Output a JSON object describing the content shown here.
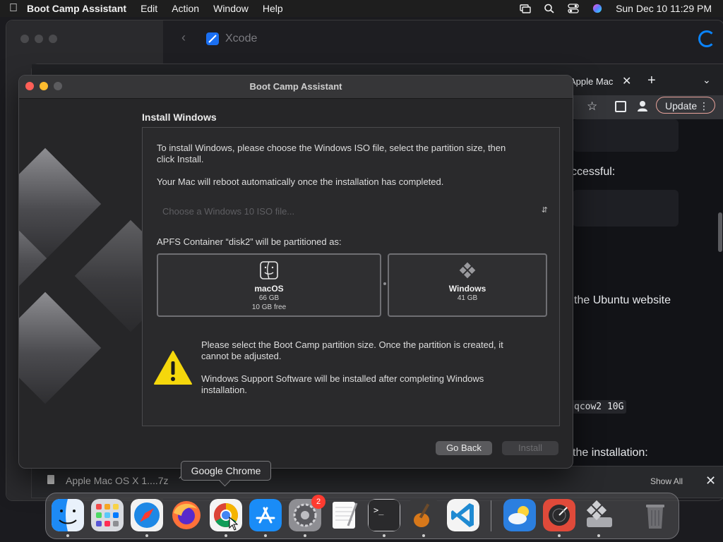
{
  "menubar": {
    "app_name": "Boot Camp Assistant",
    "menus": [
      "Edit",
      "Action",
      "Window",
      "Help"
    ],
    "datetime": "Sun Dec 10  11:29 PM",
    "icons": [
      "apple-icon",
      "screen-mirroring-icon",
      "search-icon",
      "control-center-icon",
      "siri-icon"
    ]
  },
  "xcode_window": {
    "title": "Xcode"
  },
  "chrome_window": {
    "tab_title": "Apple Mac",
    "update_label": "Update",
    "page_fragments": [
      "ccessful:",
      "the Ubuntu website",
      "qcow2 10G",
      "the installation:"
    ],
    "download_file": "Apple Mac OS X 1....7z",
    "show_all_label": "Show All"
  },
  "bootcamp": {
    "window_title": "Boot Camp Assistant",
    "heading": "Install Windows",
    "instruction_line1": "To install Windows, please choose the Windows ISO file, select the partition size, then",
    "instruction_line2": "click Install.",
    "reboot_note": "Your Mac will reboot automatically once the installation has completed.",
    "iso_placeholder": "Choose a Windows 10 ISO file...",
    "partition_label": "APFS Container “disk2” will be partitioned as:",
    "partitions": [
      {
        "name": "macOS",
        "size": "66 GB",
        "free": "10 GB free"
      },
      {
        "name": "Windows",
        "size": "41 GB"
      }
    ],
    "warning_line1": "Please select the Boot Camp partition size. Once the partition is created, it",
    "warning_line2": "cannot be adjusted.",
    "support_line1": "Windows Support Software will be installed after completing Windows",
    "support_line2": "installation.",
    "go_back_label": "Go Back",
    "install_label": "Install"
  },
  "tooltip": "Google Chrome",
  "dock": {
    "apps": [
      "Finder",
      "Launchpad",
      "Safari",
      "Firefox",
      "Google Chrome",
      "App Store",
      "System Settings",
      "TextEdit",
      "Terminal",
      "GarageBand",
      "Visual Studio Code",
      "Weather",
      "Network Radar",
      "Boot Camp Assistant",
      "Trash"
    ],
    "settings_badge": "2"
  }
}
